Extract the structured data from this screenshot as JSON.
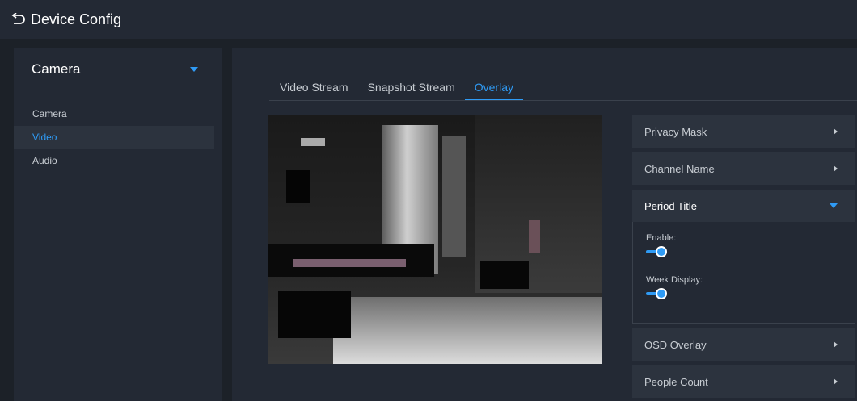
{
  "header": {
    "title": "Device Config",
    "back_icon": "back-arrow-icon"
  },
  "sidebar": {
    "section": "Camera",
    "items": [
      {
        "label": "Camera",
        "active": false
      },
      {
        "label": "Video",
        "active": true
      },
      {
        "label": "Audio",
        "active": false
      }
    ]
  },
  "tabs": [
    {
      "label": "Video Stream",
      "active": false
    },
    {
      "label": "Snapshot Stream",
      "active": false
    },
    {
      "label": "Overlay",
      "active": true
    }
  ],
  "panel": {
    "privacy_mask": "Privacy Mask",
    "channel_name": "Channel Name",
    "period_title": "Period Title",
    "enable_label": "Enable:",
    "enable_on": true,
    "week_display_label": "Week Display:",
    "week_display_on": true,
    "osd_overlay": "OSD Overlay",
    "people_count": "People Count"
  },
  "colors": {
    "accent": "#2f9bf5",
    "background": "#1c2128",
    "panel": "#232934"
  }
}
